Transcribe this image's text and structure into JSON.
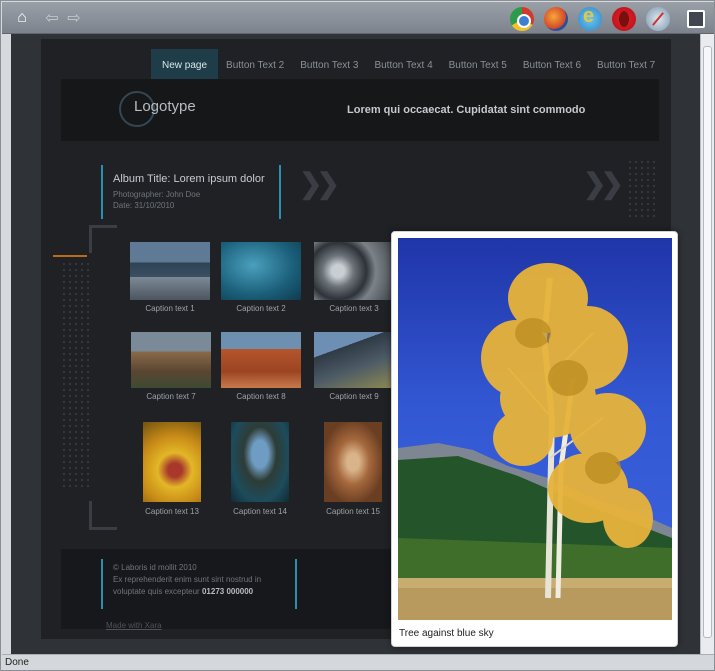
{
  "browser": {
    "icons": [
      "home-icon",
      "back-icon",
      "forward-icon",
      "chrome-icon",
      "firefox-icon",
      "ie-icon",
      "opera-icon",
      "safari-icon",
      "fullscreen-icon"
    ],
    "status": "Done"
  },
  "site": {
    "nav": [
      "New page",
      "Button Text 2",
      "Button Text 3",
      "Button Text 4",
      "Button Text 5",
      "Button Text 6",
      "Button Text 7"
    ],
    "logo": "Logotype",
    "tagline": "Lorem qui occaecat. Cupidatat sint commodo",
    "album": {
      "title": "Album Title: Lorem ipsum dolor",
      "photographer": "Photographer: John Doe",
      "date": "Date: 31/10/2010"
    },
    "captions": [
      "Caption text 1",
      "Caption text 2",
      "Caption text 3",
      "Caption text 7",
      "Caption text 8",
      "Caption text 9",
      "Caption text 13",
      "Caption text 14",
      "Caption text 15"
    ],
    "footer": {
      "copyright": "© Laboris id mollit 2010",
      "line2": "Ex reprehenderit enim sunt sint nostrud in",
      "line3_prefix": "voluptate quis excepteur",
      "phone": "01273 000000",
      "made_with": "Made with Xara"
    }
  },
  "lightbox": {
    "caption": "Tree against blue sky",
    "close": "×"
  },
  "colors": {
    "accent": "#2b8fb2",
    "orange": "#b96a1a",
    "page_bg": "#1f2125"
  }
}
